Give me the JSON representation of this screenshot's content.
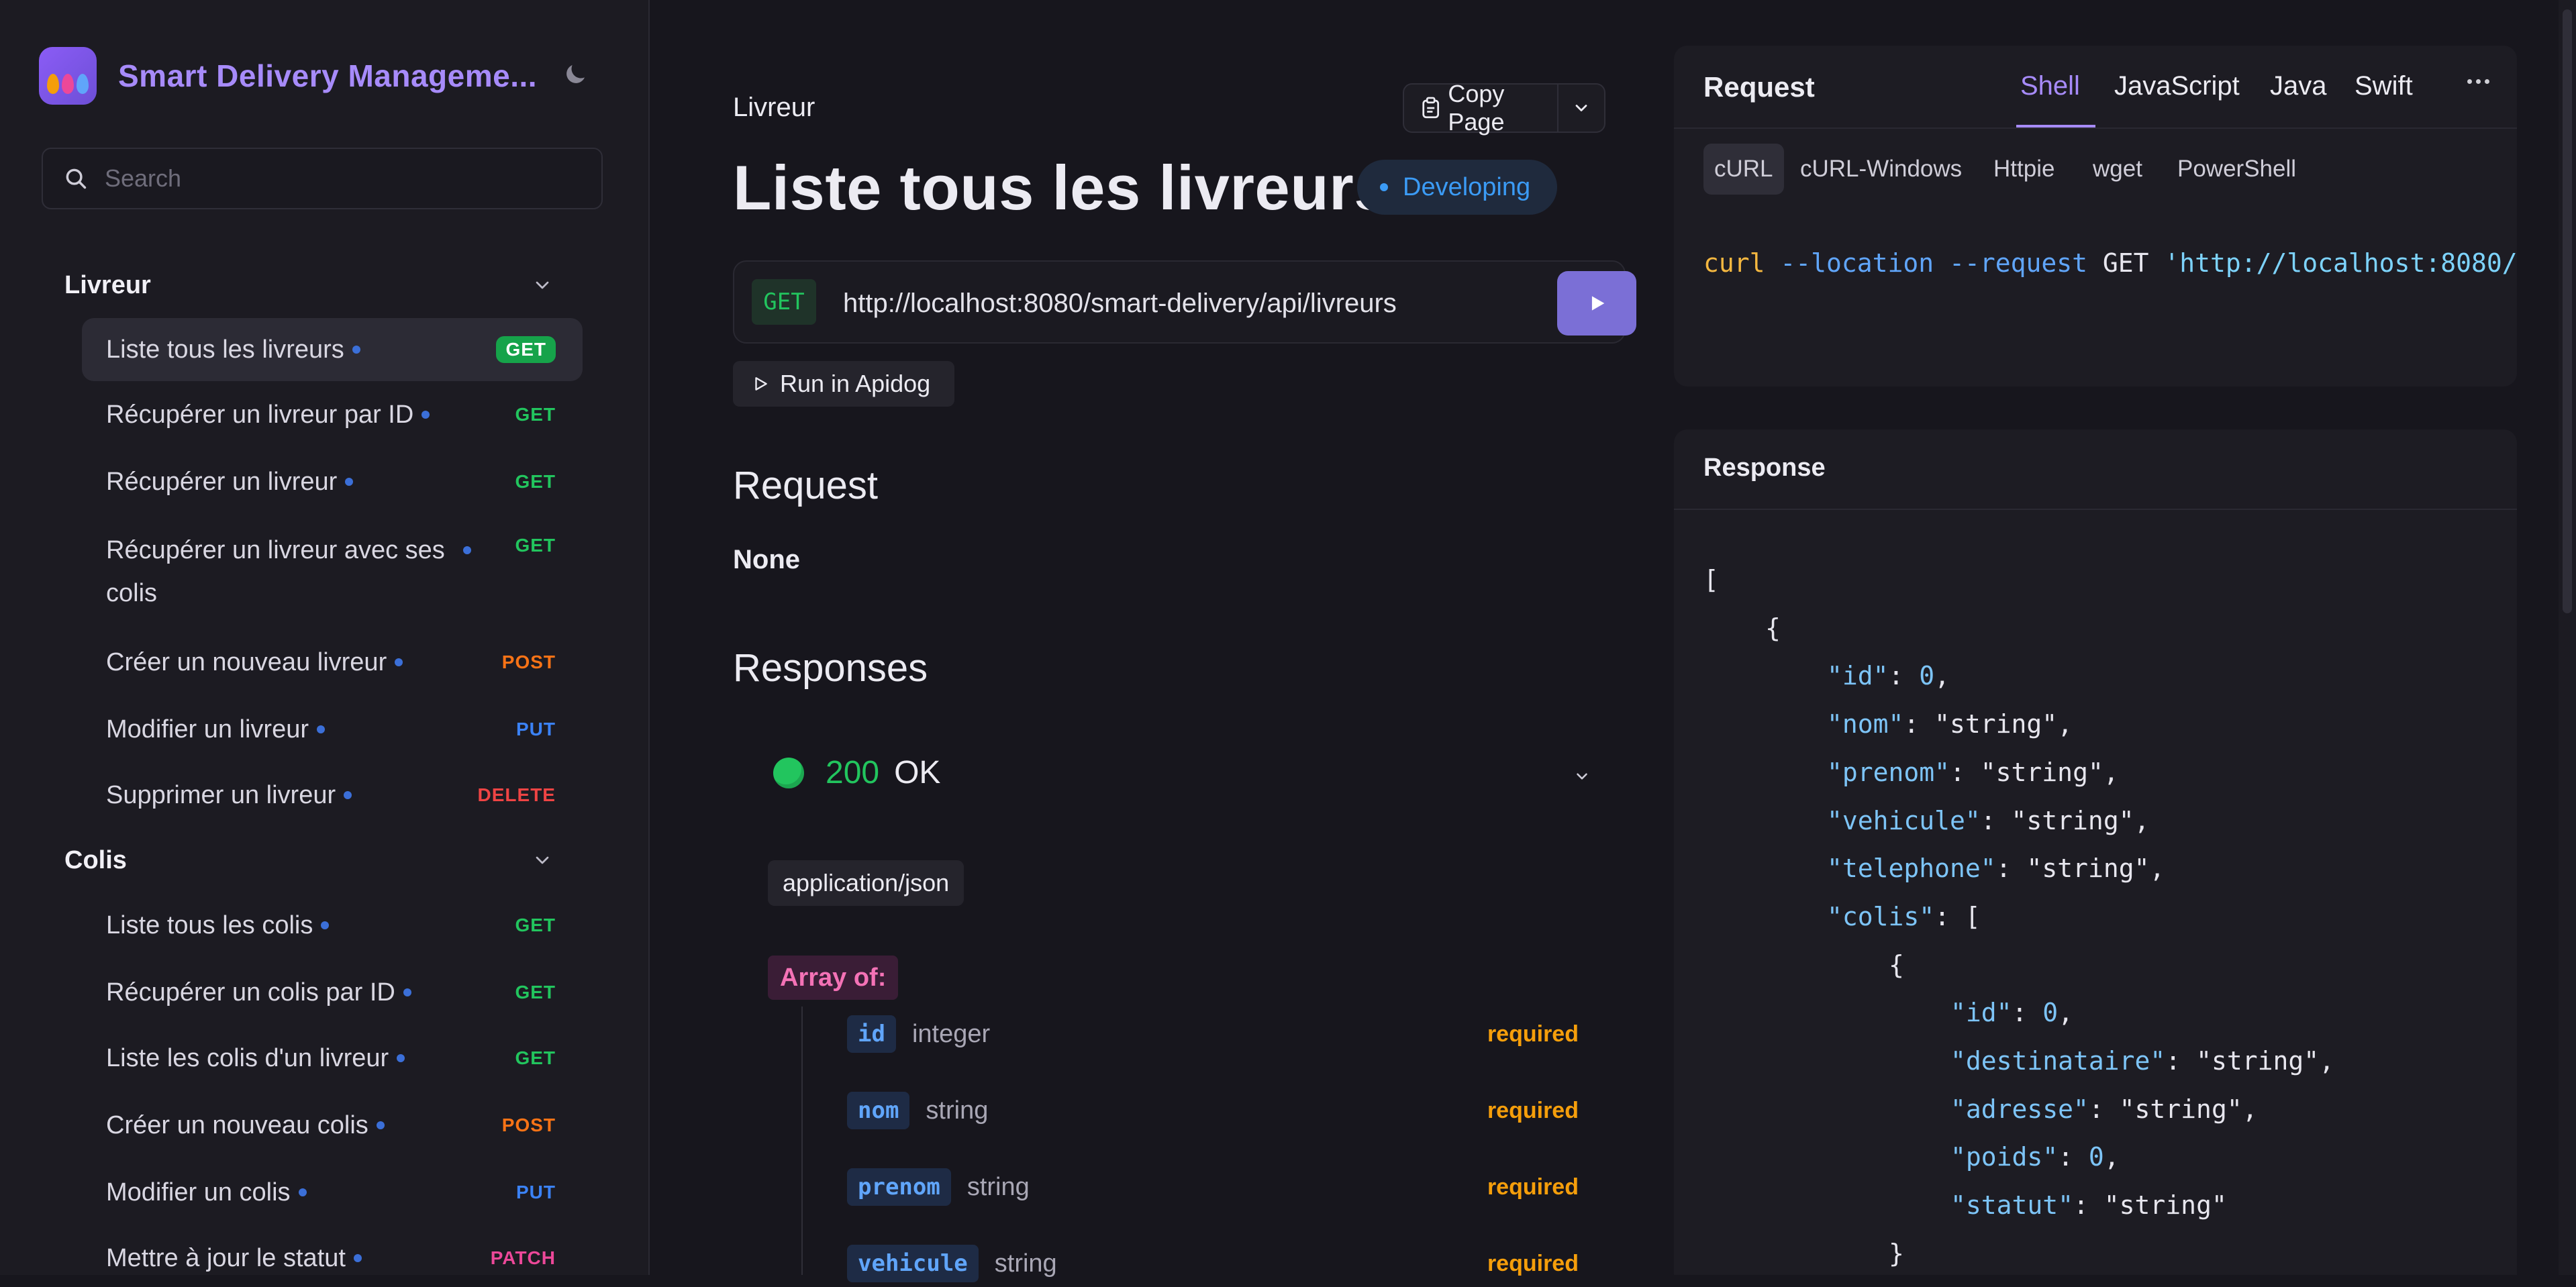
{
  "app": {
    "title": "Smart Delivery Manageme...",
    "logo_colors": [
      "#f59e0b",
      "#ec4899",
      "#60a5fa"
    ]
  },
  "search": {
    "placeholder": "Search"
  },
  "sidebar": {
    "sections": [
      {
        "title": "Livreur",
        "items": [
          {
            "label": "Liste tous les livreurs",
            "method": "GET",
            "active": true
          },
          {
            "label": "Récupérer un livreur par ID",
            "method": "GET"
          },
          {
            "label": "Récupérer un livreur",
            "method": "GET"
          },
          {
            "label": "Récupérer un livreur avec ses colis",
            "method": "GET"
          },
          {
            "label": "Créer un nouveau livreur",
            "method": "POST"
          },
          {
            "label": "Modifier un livreur",
            "method": "PUT"
          },
          {
            "label": "Supprimer un livreur",
            "method": "DELETE"
          }
        ]
      },
      {
        "title": "Colis",
        "items": [
          {
            "label": "Liste tous les colis",
            "method": "GET"
          },
          {
            "label": "Récupérer un colis par ID",
            "method": "GET"
          },
          {
            "label": "Liste les colis d'un livreur",
            "method": "GET"
          },
          {
            "label": "Créer un nouveau colis",
            "method": "POST"
          },
          {
            "label": "Modifier un colis",
            "method": "PUT"
          },
          {
            "label": "Mettre à jour le statut",
            "method": "PATCH"
          }
        ]
      }
    ]
  },
  "main": {
    "breadcrumb": "Livreur",
    "copy_page": "Copy Page",
    "title": "Liste tous les livreurs",
    "status": "Developing",
    "method": "GET",
    "url": "http://localhost:8080/smart-delivery/api/livreurs",
    "run_in": "Run in Apidog",
    "request_heading": "Request",
    "request_body": "None",
    "responses_heading": "Responses",
    "response_code": "200",
    "response_text": "OK",
    "content_type": "application/json",
    "array_of": "Array of:",
    "fields": [
      {
        "name": "id",
        "type": "integer",
        "required": "required"
      },
      {
        "name": "nom",
        "type": "string",
        "required": "required"
      },
      {
        "name": "prenom",
        "type": "string",
        "required": "required"
      },
      {
        "name": "vehicule",
        "type": "string",
        "required": "required"
      }
    ]
  },
  "request_panel": {
    "title": "Request",
    "lang_tabs": [
      "Shell",
      "JavaScript",
      "Java",
      "Swift"
    ],
    "active_lang": "Shell",
    "client_tabs": [
      "cURL",
      "cURL-Windows",
      "Httpie",
      "wget",
      "PowerShell"
    ],
    "active_client": "cURL",
    "curl": {
      "cmd": "curl",
      "opts": "--location --request",
      "method": "GET",
      "url": "'http://localhost:8080/"
    }
  },
  "response_panel": {
    "title": "Response",
    "json_lines": [
      {
        "indent": 0,
        "parts": [
          [
            "p",
            "["
          ]
        ]
      },
      {
        "indent": 1,
        "parts": [
          [
            "p",
            "{"
          ]
        ]
      },
      {
        "indent": 2,
        "parts": [
          [
            "k",
            "\"id\""
          ],
          [
            "p",
            ": "
          ],
          [
            "n",
            "0"
          ],
          [
            "p",
            ","
          ]
        ]
      },
      {
        "indent": 2,
        "parts": [
          [
            "k",
            "\"nom\""
          ],
          [
            "p",
            ": "
          ],
          [
            "s",
            "\"string\""
          ],
          [
            "p",
            ","
          ]
        ]
      },
      {
        "indent": 2,
        "parts": [
          [
            "k",
            "\"prenom\""
          ],
          [
            "p",
            ": "
          ],
          [
            "s",
            "\"string\""
          ],
          [
            "p",
            ","
          ]
        ]
      },
      {
        "indent": 2,
        "parts": [
          [
            "k",
            "\"vehicule\""
          ],
          [
            "p",
            ": "
          ],
          [
            "s",
            "\"string\""
          ],
          [
            "p",
            ","
          ]
        ]
      },
      {
        "indent": 2,
        "parts": [
          [
            "k",
            "\"telephone\""
          ],
          [
            "p",
            ": "
          ],
          [
            "s",
            "\"string\""
          ],
          [
            "p",
            ","
          ]
        ]
      },
      {
        "indent": 2,
        "parts": [
          [
            "k",
            "\"colis\""
          ],
          [
            "p",
            ": ["
          ]
        ]
      },
      {
        "indent": 3,
        "parts": [
          [
            "p",
            "{"
          ]
        ]
      },
      {
        "indent": 4,
        "parts": [
          [
            "k",
            "\"id\""
          ],
          [
            "p",
            ": "
          ],
          [
            "n",
            "0"
          ],
          [
            "p",
            ","
          ]
        ]
      },
      {
        "indent": 4,
        "parts": [
          [
            "k",
            "\"destinataire\""
          ],
          [
            "p",
            ": "
          ],
          [
            "s",
            "\"string\""
          ],
          [
            "p",
            ","
          ]
        ]
      },
      {
        "indent": 4,
        "parts": [
          [
            "k",
            "\"adresse\""
          ],
          [
            "p",
            ": "
          ],
          [
            "s",
            "\"string\""
          ],
          [
            "p",
            ","
          ]
        ]
      },
      {
        "indent": 4,
        "parts": [
          [
            "k",
            "\"poids\""
          ],
          [
            "p",
            ": "
          ],
          [
            "n",
            "0"
          ],
          [
            "p",
            ","
          ]
        ]
      },
      {
        "indent": 4,
        "parts": [
          [
            "k",
            "\"statut\""
          ],
          [
            "p",
            ": "
          ],
          [
            "s",
            "\"string\""
          ]
        ]
      },
      {
        "indent": 3,
        "parts": [
          [
            "p",
            "}"
          ]
        ]
      }
    ]
  },
  "colors": {
    "accent": "#a78bfa",
    "get": "#22c55e",
    "post": "#f97316",
    "put": "#3b82f6",
    "delete": "#ef4444",
    "patch": "#ec4899",
    "developing": "#3b9bf5",
    "required": "#f59e0b"
  }
}
